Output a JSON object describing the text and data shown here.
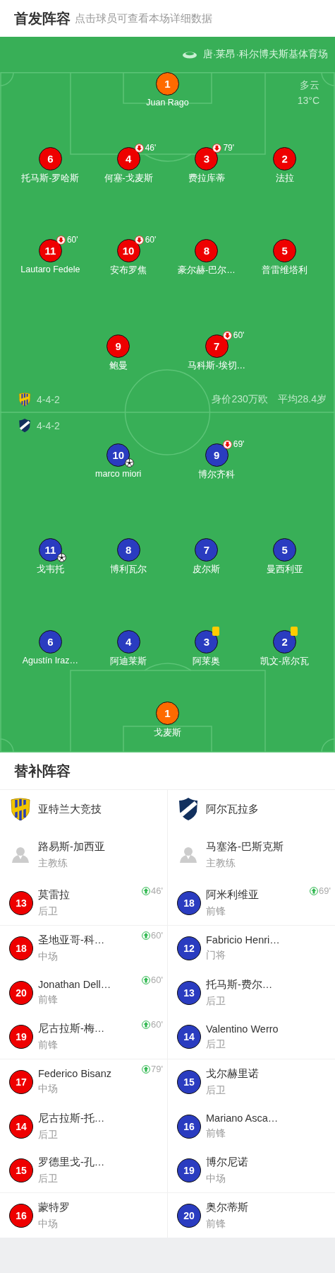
{
  "header": {
    "title": "首发阵容",
    "subtitle": "点击球员可查看本场详细数据"
  },
  "pitch": {
    "stadium": "唐·莱昂·科尔博夫斯基体育场",
    "weather": "多云",
    "temperature": "13°C",
    "home": {
      "formation": "4-4-2",
      "team_value": "身价230万欧",
      "average_age": "平均28.4岁",
      "lines": [
        {
          "kind": "goalkeeper",
          "players": [
            {
              "number": "1",
              "name": "Juan Rago",
              "goal": false,
              "yellow_card": false
            }
          ]
        },
        {
          "kind": "outfield",
          "players": [
            {
              "number": "6",
              "name": "托马斯-罗哈斯",
              "goal": false,
              "yellow_card": false
            },
            {
              "number": "4",
              "name": "何塞-戈麦斯",
              "substituted": "46'",
              "goal": false,
              "yellow_card": false
            },
            {
              "number": "3",
              "name": "费拉库蒂",
              "substituted": "79'",
              "goal": false,
              "yellow_card": false
            },
            {
              "number": "2",
              "name": "法拉",
              "goal": false,
              "yellow_card": false
            }
          ]
        },
        {
          "kind": "outfield",
          "players": [
            {
              "number": "11",
              "name": "Lautaro Fedele",
              "substituted": "60'",
              "goal": false,
              "yellow_card": false
            },
            {
              "number": "10",
              "name": "安布罗焦",
              "substituted": "60'",
              "goal": false,
              "yellow_card": false
            },
            {
              "number": "8",
              "name": "豪尔赫-巴尔…",
              "goal": false,
              "yellow_card": false
            },
            {
              "number": "5",
              "name": "普雷维塔利",
              "goal": false,
              "yellow_card": false
            }
          ]
        },
        {
          "kind": "outfield",
          "players": [
            {
              "number": "9",
              "name": "鲍曼",
              "goal": false,
              "yellow_card": false
            },
            {
              "number": "7",
              "name": "马科斯-埃切…",
              "substituted": "60'",
              "goal": false,
              "yellow_card": false
            }
          ]
        }
      ]
    },
    "away": {
      "formation": "4-4-2",
      "lines": [
        {
          "kind": "outfield",
          "players": [
            {
              "number": "10",
              "name": "marco miori",
              "goal": true,
              "yellow_card": false
            },
            {
              "number": "9",
              "name": "博尔齐科",
              "substituted": "69'",
              "goal": false,
              "yellow_card": false
            }
          ]
        },
        {
          "kind": "outfield",
          "players": [
            {
              "number": "11",
              "name": "戈韦托",
              "goal": true,
              "yellow_card": false
            },
            {
              "number": "8",
              "name": "博利瓦尔",
              "goal": false,
              "yellow_card": false
            },
            {
              "number": "7",
              "name": "皮尔斯",
              "goal": false,
              "yellow_card": false
            },
            {
              "number": "5",
              "name": "曼西利亚",
              "goal": false,
              "yellow_card": false
            }
          ]
        },
        {
          "kind": "outfield",
          "players": [
            {
              "number": "6",
              "name": "Agustín Iraz…",
              "goal": false,
              "yellow_card": false
            },
            {
              "number": "4",
              "name": "阿迪莱斯",
              "goal": false,
              "yellow_card": false
            },
            {
              "number": "3",
              "name": "阿莱奥",
              "goal": false,
              "yellow_card": true
            },
            {
              "number": "2",
              "name": "凯文-席尔瓦",
              "goal": false,
              "yellow_card": true
            }
          ]
        },
        {
          "kind": "goalkeeper",
          "players": [
            {
              "number": "1",
              "name": "戈麦斯",
              "goal": false,
              "yellow_card": false
            }
          ]
        }
      ]
    }
  },
  "substitutes": {
    "title": "替补阵容",
    "teams": [
      {
        "kind": "home",
        "name": "亚特兰大竞技",
        "coach": {
          "name": "路易斯-加西亚",
          "role": "主教练"
        },
        "players": [
          {
            "number": "13",
            "name": "莫雷拉",
            "position": "后卫",
            "substituted_in": "46'"
          },
          {
            "number": "18",
            "name": "圣地亚哥-科…",
            "position": "中场",
            "substituted_in": "60'"
          },
          {
            "number": "20",
            "name": "Jonathan Dell…",
            "position": "前锋",
            "substituted_in": "60'"
          },
          {
            "number": "19",
            "name": "尼古拉斯-梅…",
            "position": "前锋",
            "substituted_in": "60'"
          },
          {
            "number": "17",
            "name": "Federico Bisanz",
            "position": "中场",
            "substituted_in": "79'"
          },
          {
            "number": "14",
            "name": "尼古拉斯-托…",
            "position": "后卫"
          },
          {
            "number": "15",
            "name": "罗德里戈-孔…",
            "position": "后卫"
          },
          {
            "number": "16",
            "name": "蒙特罗",
            "position": "中场"
          }
        ]
      },
      {
        "kind": "away",
        "name": "阿尔瓦拉多",
        "coach": {
          "name": "马塞洛-巴斯克斯",
          "role": "主教练"
        },
        "players": [
          {
            "number": "18",
            "name": "阿米利维亚",
            "position": "前锋",
            "substituted_in": "69'"
          },
          {
            "number": "12",
            "name": "Fabricio Henri…",
            "position": "门将"
          },
          {
            "number": "13",
            "name": "托马斯-费尔…",
            "position": "后卫"
          },
          {
            "number": "14",
            "name": "Valentino Werro",
            "position": "后卫"
          },
          {
            "number": "15",
            "name": "戈尔赫里诺",
            "position": "后卫"
          },
          {
            "number": "16",
            "name": "Mariano Asca…",
            "position": "前锋"
          },
          {
            "number": "19",
            "name": "博尔尼诺",
            "position": "中场"
          },
          {
            "number": "20",
            "name": "奥尔蒂斯",
            "position": "前锋"
          }
        ]
      }
    ]
  }
}
